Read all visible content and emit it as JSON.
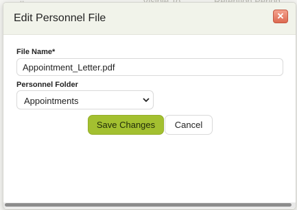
{
  "background": {
    "columns": [
      "Visible To",
      "Retention Period"
    ]
  },
  "dialog": {
    "title": "Edit Personnel File",
    "close_icon": "close-x-icon",
    "fields": {
      "file_name": {
        "label": "File Name*",
        "value": "Appointment_Letter.pdf"
      },
      "personnel_folder": {
        "label": "Personnel Folder",
        "selected": "Appointments"
      }
    },
    "buttons": {
      "save": "Save Changes",
      "cancel": "Cancel"
    }
  },
  "colors": {
    "header_bg": "#f1f3ea",
    "save_button": "#a3c030",
    "close_button": "#dd6a52"
  }
}
